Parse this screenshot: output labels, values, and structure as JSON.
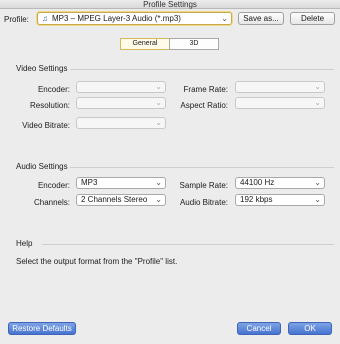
{
  "window": {
    "title": "Profile Settings"
  },
  "profile": {
    "label": "Profile:",
    "value": "MP3 – MPEG Layer-3 Audio (*.mp3)",
    "save_as_label": "Save as...",
    "delete_label": "Delete"
  },
  "tabs": [
    {
      "label": "General",
      "active": true
    },
    {
      "label": "3D",
      "active": false
    }
  ],
  "video": {
    "section_title": "Video Settings",
    "encoder_label": "Encoder:",
    "encoder_value": "",
    "resolution_label": "Resolution:",
    "resolution_value": "",
    "bitrate_label": "Video Bitrate:",
    "bitrate_value": "",
    "frame_rate_label": "Frame Rate:",
    "frame_rate_value": "",
    "aspect_ratio_label": "Aspect Ratio:",
    "aspect_ratio_value": ""
  },
  "audio": {
    "section_title": "Audio Settings",
    "encoder_label": "Encoder:",
    "encoder_value": "MP3",
    "channels_label": "Channels:",
    "channels_value": "2 Channels Stereo",
    "sample_rate_label": "Sample Rate:",
    "sample_rate_value": "44100 Hz",
    "bitrate_label": "Audio Bitrate:",
    "bitrate_value": "192 kbps"
  },
  "help": {
    "section_title": "Help",
    "text": "Select the output format from the \"Profile\" list."
  },
  "footer": {
    "restore_label": "Restore Defaults",
    "cancel_label": "Cancel",
    "ok_label": "OK"
  },
  "colors": {
    "primary_button": "#4674cf",
    "active_tab": "#fffbe8",
    "window_bg": "#ececec"
  },
  "icons": {
    "profile_format": "audio-format-icon",
    "dropdown": "chevron-down-icon"
  }
}
